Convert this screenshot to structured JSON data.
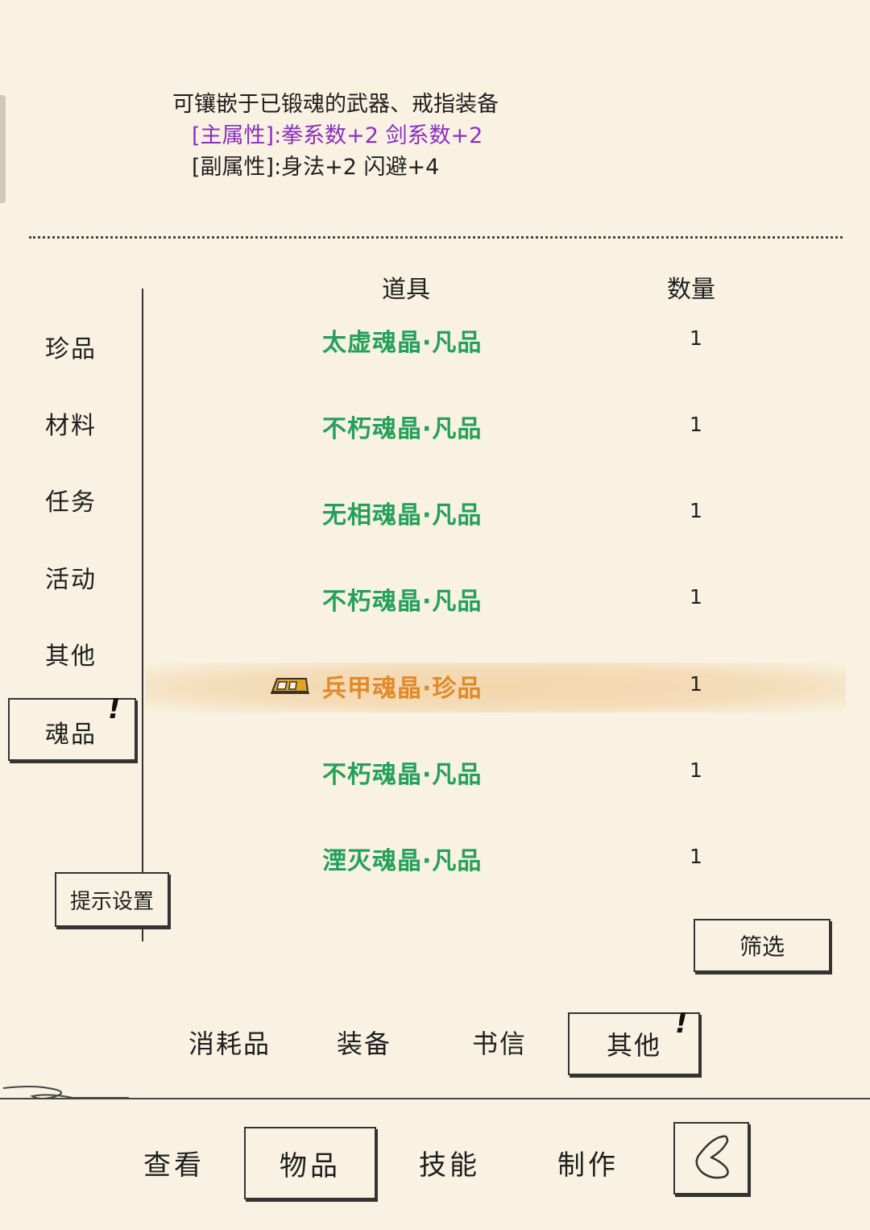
{
  "description": {
    "line1": "可镶嵌于已锻魂的武器、戒指装备",
    "main_attr": "[主属性]:拳系数+2 剑系数+2",
    "sub_attr": "[副属性]:身法+2 闪避+4"
  },
  "sidebar": {
    "items": [
      {
        "label": "珍品"
      },
      {
        "label": "材料"
      },
      {
        "label": "任务"
      },
      {
        "label": "活动"
      },
      {
        "label": "其他"
      },
      {
        "label": "魂品",
        "active": true,
        "alert": "!"
      }
    ],
    "hint_button": "提示设置"
  },
  "table": {
    "headers": {
      "item": "道具",
      "count": "数量"
    },
    "rows": [
      {
        "name": "太虚魂晶·凡品",
        "count": "1",
        "rarity": "common"
      },
      {
        "name": "不朽魂晶·凡品",
        "count": "1",
        "rarity": "common"
      },
      {
        "name": "无相魂晶·凡品",
        "count": "1",
        "rarity": "common"
      },
      {
        "name": "不朽魂晶·凡品",
        "count": "1",
        "rarity": "common"
      },
      {
        "name": "兵甲魂晶·珍品",
        "count": "1",
        "rarity": "rare",
        "selected": true,
        "icon": "rare-item-icon"
      },
      {
        "name": "不朽魂晶·凡品",
        "count": "1",
        "rarity": "common"
      },
      {
        "name": "湮灭魂晶·凡品",
        "count": "1",
        "rarity": "common"
      }
    ]
  },
  "filter_button": "筛选",
  "subtabs": [
    {
      "label": "消耗品"
    },
    {
      "label": "装备"
    },
    {
      "label": "书信"
    },
    {
      "label": "其他",
      "active": true,
      "alert": "!"
    }
  ],
  "bottom_nav": [
    {
      "label": "查看"
    },
    {
      "label": "物品",
      "active": true
    },
    {
      "label": "技能"
    },
    {
      "label": "制作"
    }
  ],
  "colors": {
    "background": "#f9f2e3",
    "common_item": "#25a05a",
    "rare_item": "#e08a2a",
    "main_attr": "#8a2fc0",
    "text": "#1e1e1e"
  }
}
